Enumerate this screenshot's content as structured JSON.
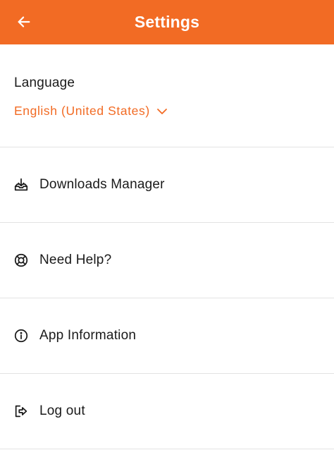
{
  "header": {
    "title": "Settings",
    "back_icon": "arrow-left-icon",
    "background_color": "#f26b24"
  },
  "language": {
    "label": "Language",
    "selected": "English (United States)",
    "chevron_icon": "chevron-down-icon",
    "accent_color": "#f26b24"
  },
  "menu": {
    "items": [
      {
        "label": "Downloads Manager",
        "icon": "download-tray-icon"
      },
      {
        "label": "Need Help?",
        "icon": "lifebuoy-icon"
      },
      {
        "label": "App Information",
        "icon": "info-icon"
      },
      {
        "label": "Log out",
        "icon": "logout-icon"
      }
    ]
  }
}
